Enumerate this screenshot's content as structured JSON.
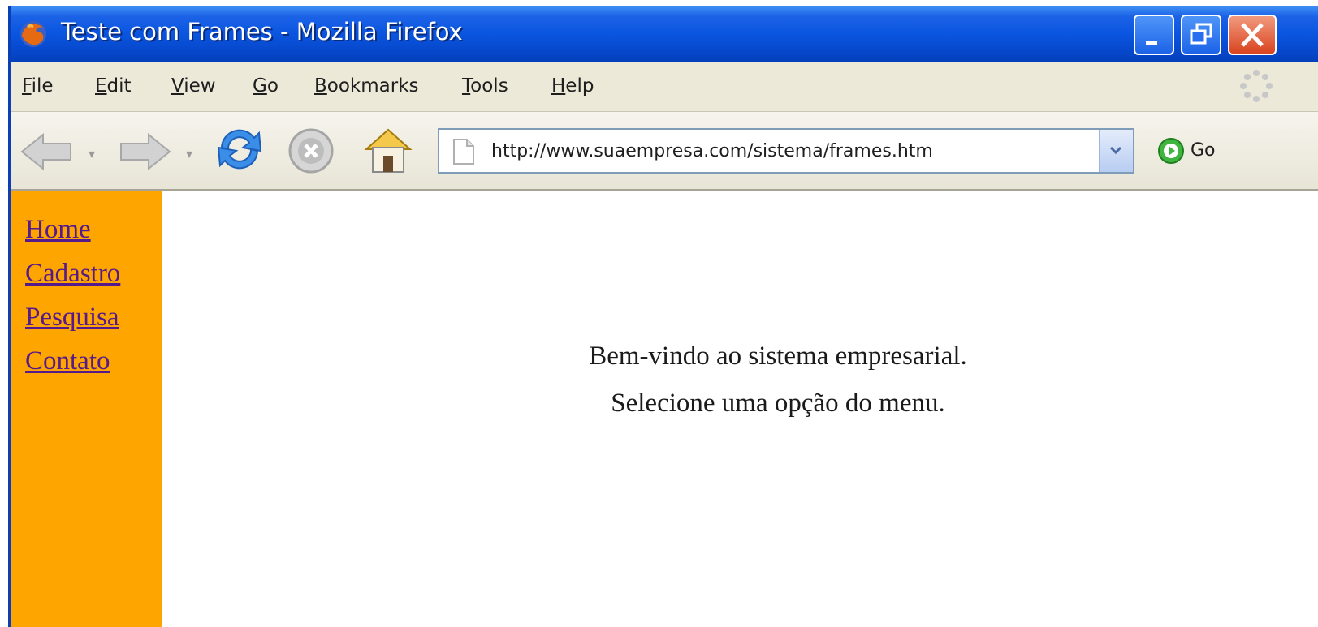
{
  "window": {
    "title": "Teste com Frames - Mozilla Firefox"
  },
  "menubar": {
    "items": [
      {
        "mnemonic": "F",
        "rest": "ile"
      },
      {
        "mnemonic": "E",
        "rest": "dit"
      },
      {
        "mnemonic": "V",
        "rest": "iew"
      },
      {
        "mnemonic": "G",
        "rest": "o"
      },
      {
        "mnemonic": "B",
        "rest": "ookmarks"
      },
      {
        "mnemonic": "T",
        "rest": "ools"
      },
      {
        "mnemonic": "H",
        "rest": "elp"
      }
    ]
  },
  "navbar": {
    "url": "http://www.suaempresa.com/sistema/frames.htm",
    "go_label": "Go"
  },
  "side_menu": {
    "links": [
      "Home",
      "Cadastro",
      "Pesquisa",
      "Contato"
    ],
    "background": "#ffa500",
    "link_color": "#551a8b"
  },
  "main": {
    "line1": "Bem-vindo ao sistema empresarial.",
    "line2": "Selecione uma opção do menu."
  }
}
